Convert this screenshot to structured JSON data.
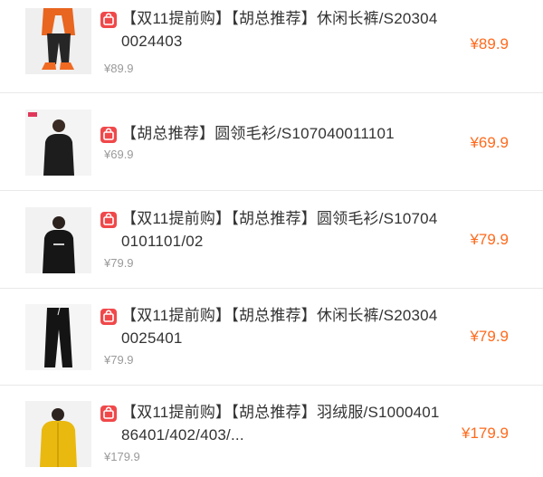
{
  "currency": "¥",
  "colors": {
    "price": "#ff6a1c",
    "badge": "#f0484a",
    "title": "#333333",
    "sub_price": "#9a9a9a",
    "divider": "#e9e9e9"
  },
  "items": [
    {
      "title": "【双11提前购】【胡总推荐】休闲长裤/S203040024403",
      "sub_price": "¥89.9",
      "price": "¥89.9",
      "image": "orange-jacket-black-pants-model"
    },
    {
      "title": "【胡总推荐】圆领毛衫/S107040011101",
      "sub_price": "¥69.9",
      "price": "¥69.9",
      "image": "black-sweater-model"
    },
    {
      "title": "【双11提前购】【胡总推荐】圆领毛衫/S107040101101/02",
      "sub_price": "¥79.9",
      "price": "¥79.9",
      "image": "black-sweater-model"
    },
    {
      "title": "【双11提前购】【胡总推荐】休闲长裤/S203040025401",
      "sub_price": "¥79.9",
      "price": "¥79.9",
      "image": "black-pants-product"
    },
    {
      "title": "【双11提前购】【胡总推荐】羽绒服/S100040186401/402/403/...",
      "sub_price": "¥179.9",
      "price": "¥179.9",
      "image": "yellow-down-jacket-model"
    }
  ]
}
